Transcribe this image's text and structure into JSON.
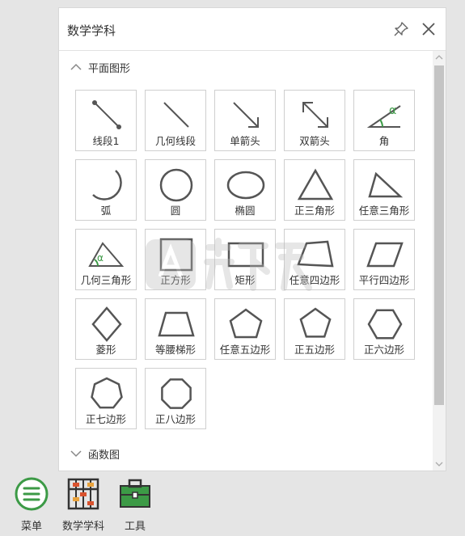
{
  "panel": {
    "title": "数学学科",
    "sections": [
      {
        "label": "平面图形",
        "expanded": true
      },
      {
        "label": "函数图",
        "expanded": false
      }
    ]
  },
  "shapes": [
    {
      "icon": "line-segment-icon",
      "label": "线段1"
    },
    {
      "icon": "geometry-line-icon",
      "label": "几何线段"
    },
    {
      "icon": "single-arrow-icon",
      "label": "单箭头"
    },
    {
      "icon": "double-arrow-icon",
      "label": "双箭头"
    },
    {
      "icon": "angle-icon",
      "label": "角"
    },
    {
      "icon": "arc-icon",
      "label": "弧"
    },
    {
      "icon": "circle-icon",
      "label": "圆"
    },
    {
      "icon": "ellipse-icon",
      "label": "椭圆"
    },
    {
      "icon": "equilateral-triangle-icon",
      "label": "正三角形"
    },
    {
      "icon": "any-triangle-icon",
      "label": "任意三角形"
    },
    {
      "icon": "geometry-triangle-icon",
      "label": "几何三角形"
    },
    {
      "icon": "square-icon",
      "label": "正方形"
    },
    {
      "icon": "rectangle-icon",
      "label": "矩形"
    },
    {
      "icon": "any-quadrilateral-icon",
      "label": "任意四边形"
    },
    {
      "icon": "parallelogram-icon",
      "label": "平行四边形"
    },
    {
      "icon": "rhombus-icon",
      "label": "菱形"
    },
    {
      "icon": "isosceles-trapezoid-icon",
      "label": "等腰梯形"
    },
    {
      "icon": "any-pentagon-icon",
      "label": "任意五边形"
    },
    {
      "icon": "regular-pentagon-icon",
      "label": "正五边形"
    },
    {
      "icon": "regular-hexagon-icon",
      "label": "正六边形"
    },
    {
      "icon": "regular-heptagon-icon",
      "label": "正七边形"
    },
    {
      "icon": "regular-octagon-icon",
      "label": "正八边形"
    }
  ],
  "angle_symbol": "α",
  "bottom_bar": [
    {
      "icon": "menu-icon",
      "label": "菜单"
    },
    {
      "icon": "abacus-icon",
      "label": "数学学科"
    },
    {
      "icon": "toolbox-icon",
      "label": "工具"
    }
  ],
  "colors": {
    "accent_green": "#3c9a46",
    "shape_stroke": "#555555"
  }
}
